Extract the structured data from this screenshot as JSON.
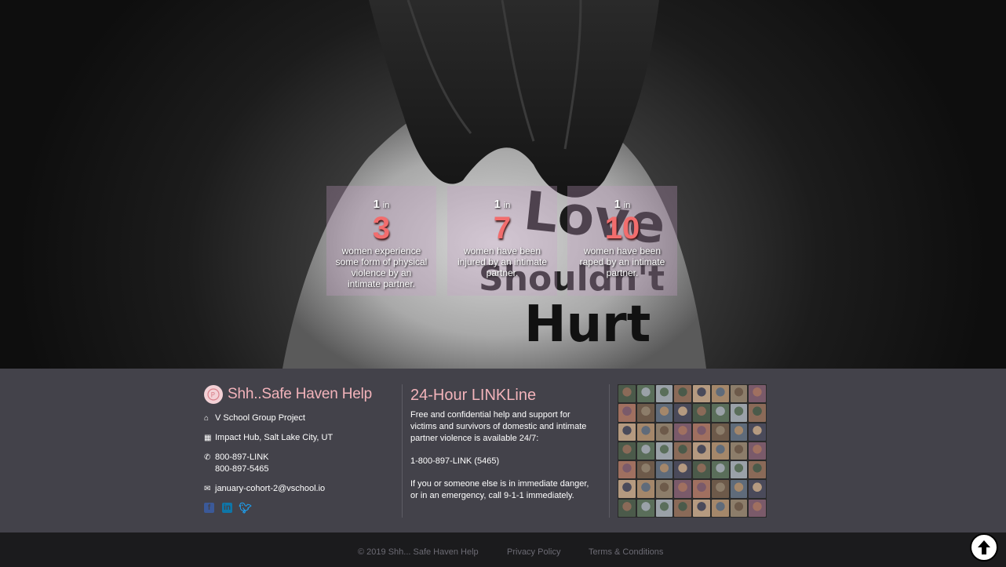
{
  "stats": [
    {
      "one": "1",
      "in": "in",
      "number": "3",
      "description": "women experience some form of physical violence by an intimate partner."
    },
    {
      "one": "1",
      "in": "in",
      "number": "7",
      "description": "women have been injured by an intimate partner."
    },
    {
      "one": "1",
      "in": "in",
      "number": "10",
      "description": "women have been raped by an intimate partner."
    }
  ],
  "hero": {
    "painted_words": [
      "Love",
      "Shouldn't",
      "Hurt"
    ]
  },
  "footer": {
    "brand": "Shh..Safe Haven Help",
    "project": "V School Group Project",
    "location": "Impact Hub, Salt Lake City, UT",
    "phone_primary": "800-897-LINK",
    "phone_secondary": "800-897-5465",
    "email": "january-cohort-2@vschool.io",
    "socials": [
      "facebook-icon",
      "linkedin-icon",
      "twitter-icon"
    ],
    "line_title": "24-Hour LINKLine",
    "line_text": "Free and confidential help and support for victims and survivors of domestic and intimate partner violence is available 24/7:",
    "line_phone": "1-800-897-LINK (5465)",
    "line_emergency": "If you or someone else is in immediate danger, or in an emergency, call 9-1-1 immediately."
  },
  "bottom": {
    "copyright": "© 2019 Shh... Safe Haven Help",
    "privacy": "Privacy Policy",
    "terms": "Terms & Conditions"
  },
  "colors": {
    "accent_pink": "#f2b3ba",
    "stat_red": "#f26d6d",
    "footer_bg": "#43424a"
  }
}
